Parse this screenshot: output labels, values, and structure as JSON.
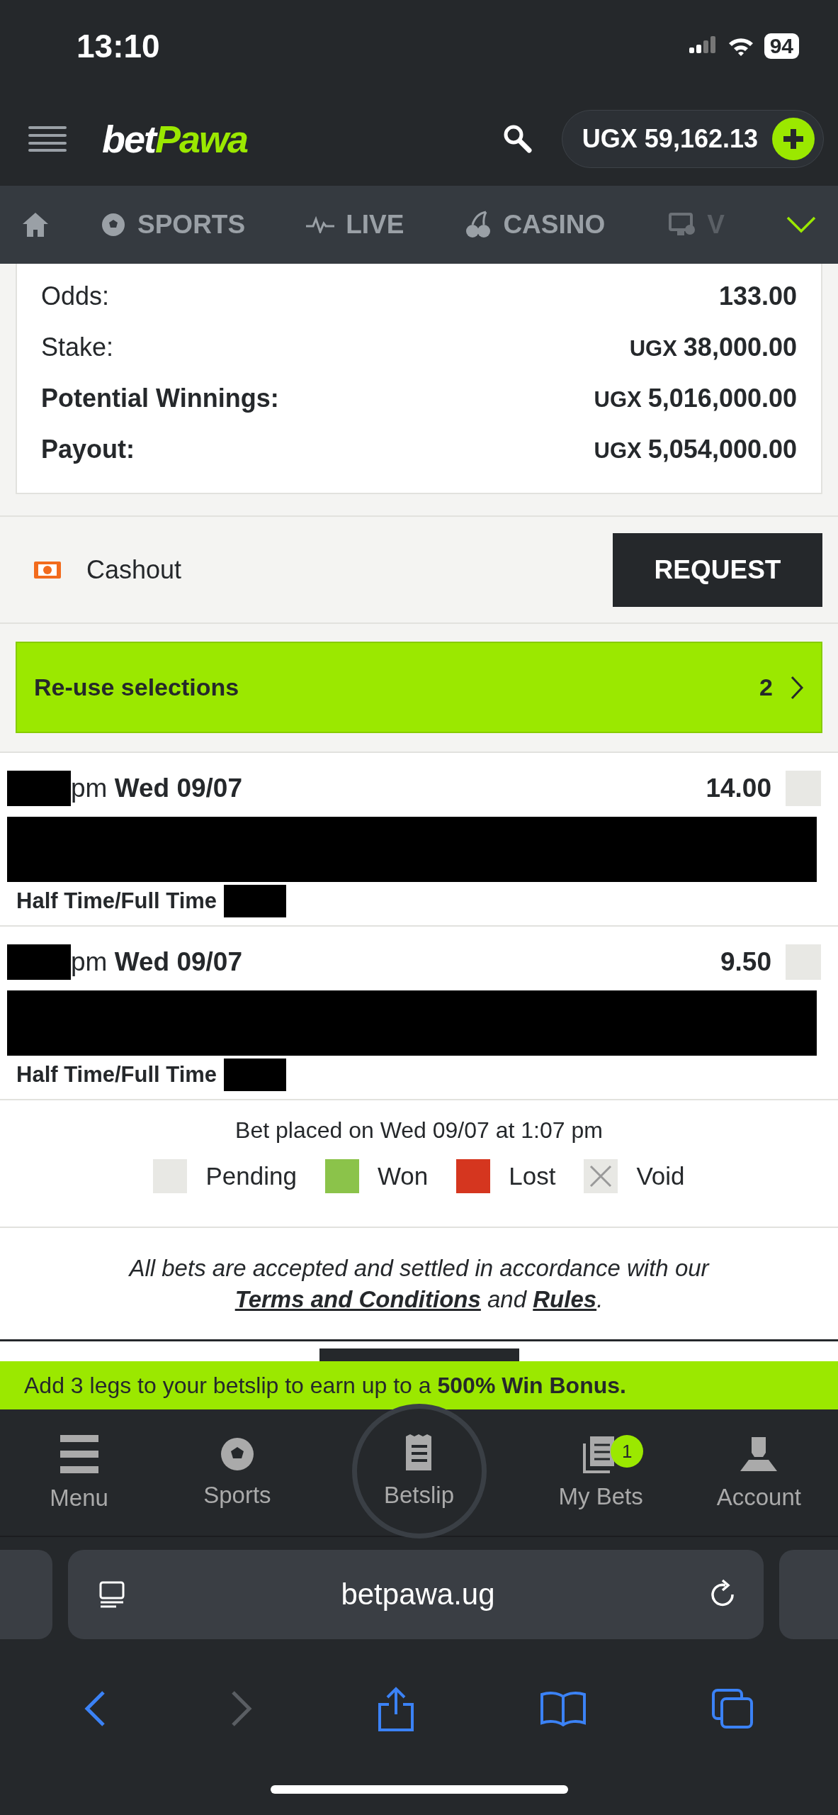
{
  "status_bar": {
    "time": "13:10",
    "battery": "94"
  },
  "header": {
    "logo_left": "bet",
    "logo_right": "Pawa",
    "balance": "UGX 59,162.13"
  },
  "nav_tabs": [
    {
      "label": "SPORTS",
      "kind": "sports"
    },
    {
      "label": "LIVE",
      "kind": "live"
    },
    {
      "label": "CASINO",
      "kind": "casino"
    },
    {
      "label": "V",
      "kind": "virtual"
    }
  ],
  "summary": [
    {
      "label": "Odds:",
      "value": "133.00",
      "bold": false
    },
    {
      "label": "Stake:",
      "currency": "UGX",
      "value": "38,000.00",
      "bold": false
    },
    {
      "label": "Potential Winnings:",
      "currency": "UGX",
      "value": "5,016,000.00",
      "bold": true
    },
    {
      "label": "Payout:",
      "currency": "UGX",
      "value": "5,054,000.00",
      "bold": true
    }
  ],
  "cashout": {
    "label": "Cashout",
    "button": "REQUEST"
  },
  "reuse": {
    "label": "Re-use selections",
    "count": "2"
  },
  "selections": [
    {
      "time_suffix": "pm",
      "date": "Wed 09/07",
      "odds": "14.00",
      "market": "Half Time/Full Time",
      "color": "#e8e8e4"
    },
    {
      "time_suffix": "pm",
      "date": "Wed 09/07",
      "odds": "9.50",
      "market": "Half Time/Full Time",
      "color": "#e8e8e4"
    }
  ],
  "bet_placed": "Bet placed on Wed 09/07 at 1:07 pm",
  "legend": [
    {
      "label": "Pending",
      "kind": "plain",
      "color": "#e8e8e4"
    },
    {
      "label": "Won",
      "kind": "plain",
      "color": "#8bc34a"
    },
    {
      "label": "Lost",
      "kind": "plain",
      "color": "#d5361f"
    },
    {
      "label": "Void",
      "kind": "cross",
      "color": "#e8e8e4"
    }
  ],
  "terms": {
    "before": "All bets are accepted and settled in accordance with our",
    "link1": "Terms and Conditions",
    "middle": "and",
    "link2": "Rules",
    "after": "."
  },
  "promo": "Add 3 legs to your betslip to earn up to a **500% Win Bonus.**",
  "bottom_nav": [
    {
      "label": "Menu",
      "kind": "menu"
    },
    {
      "label": "Sports",
      "kind": "sports"
    },
    {
      "label": "Betslip",
      "kind": "betslip"
    },
    {
      "label": "My Bets",
      "kind": "mybets",
      "badge": "1"
    },
    {
      "label": "Account",
      "kind": "account"
    }
  ],
  "browser": {
    "url": "betpawa.ug"
  }
}
